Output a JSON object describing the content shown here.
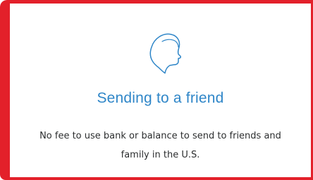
{
  "card": {
    "title": "Sending to a friend",
    "description": "No fee to use bank or balance to send to friends and family in the U.S.",
    "icon": "friend-head-icon"
  },
  "colors": {
    "frame_border": "#e3202a",
    "title": "#2f86c8",
    "icon_stroke": "#2f86c8",
    "text": "#2c2e2f"
  }
}
